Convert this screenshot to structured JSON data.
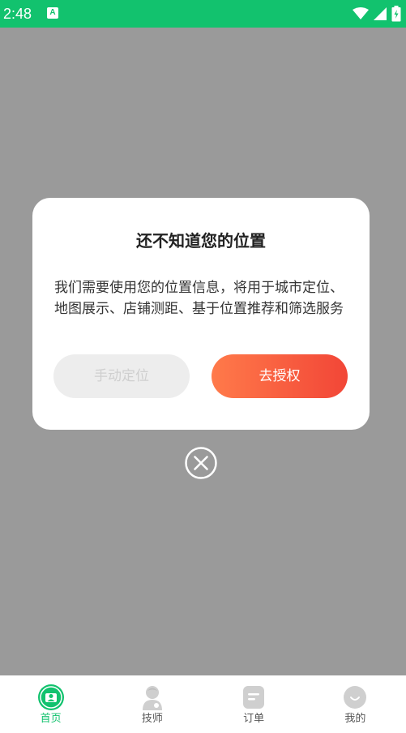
{
  "status_bar": {
    "time": "2:48",
    "app_icon_letter": "A",
    "background_color": "#12c26e",
    "icons": [
      "wifi-icon",
      "signal-icon",
      "battery-charging-icon"
    ]
  },
  "dialog": {
    "title": "还不知道您的位置",
    "message": "我们需要使用您的位置信息，将用于城市定位、地图展示、店铺测距、基于位置推荐和筛选服务",
    "manual_button_label": "手动定位",
    "authorize_button_label": "去授权",
    "accent_gradient": [
      "#ff7a4a",
      "#f24637"
    ]
  },
  "close_button": {
    "icon": "close-circle-icon"
  },
  "tab_bar": {
    "active_color": "#12c26e",
    "items": [
      {
        "label": "首页",
        "icon": "home-icon",
        "active": true
      },
      {
        "label": "技师",
        "icon": "technician-icon",
        "active": false
      },
      {
        "label": "订单",
        "icon": "order-icon",
        "active": false
      },
      {
        "label": "我的",
        "icon": "profile-icon",
        "active": false
      }
    ]
  }
}
